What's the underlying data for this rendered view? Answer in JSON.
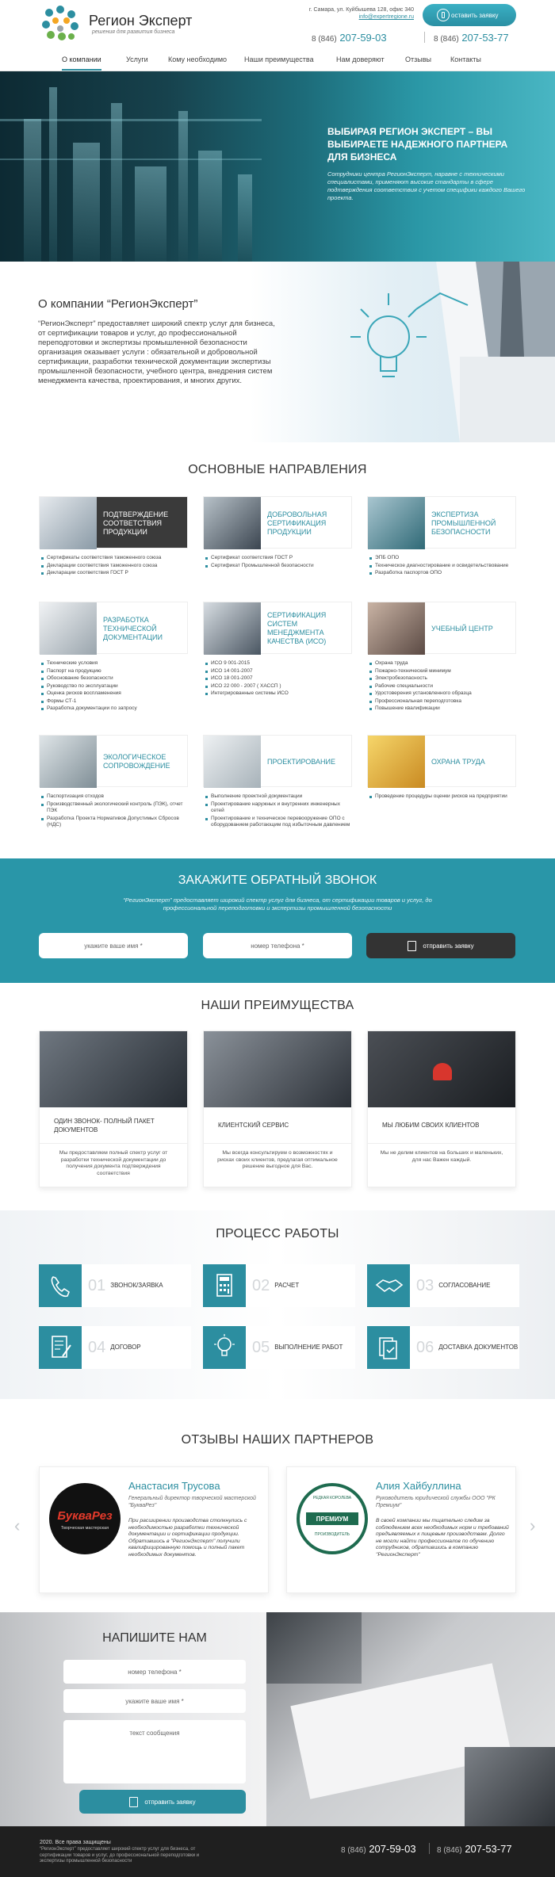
{
  "header": {
    "logo_title": "Регион Эксперт",
    "logo_subtitle": "решения для развития бизнеса",
    "address": "г. Самара, ул. Куйбышева 128, офис 340",
    "email": "info@expertregione.ru",
    "cta_label": "оставить заявку",
    "phone1_prefix": "8 (846)",
    "phone1": "207-59-03",
    "phone2_prefix": "8 (846)",
    "phone2": "207-53-77"
  },
  "nav": {
    "items": [
      "О компании",
      "Услуги",
      "Кому необходимо",
      "Наши преимущества",
      "Нам доверяют",
      "Отзывы",
      "Контакты"
    ],
    "active_index": 0
  },
  "hero": {
    "title": "ВЫБИРАЯ РЕГИОН ЭКСПЕРТ – ВЫ ВЫБИРАЕТЕ НАДЕЖНОГО ПАРТНЕРА ДЛЯ БИЗНЕСА",
    "text": "Сотрудники центра РегионЭксперт, наравне с техническими специалистами, применяют высокие стандарты в сфере подтверждения соответствия с учетом специфики каждого Вашего проекта."
  },
  "about": {
    "title": "О компании “РегионЭксперт”",
    "text": "“РегионЭксперт” предоставляет широкий спектр услуг для бизнеса, от сертификации товаров и услуг, до профессиональной переподготовки и экспертизы промышленной безопасности организация оказывает услуги : обязательной и добровольной сертификации, разработки технической документации экспертизы промышленной безопасности, учебного центра, внедрения систем менеджмента качества, проектирования, и многих других."
  },
  "directions": {
    "title": "ОСНОВНЫЕ НАПРАВЛЕНИЯ",
    "cards": [
      {
        "title": "ПОДТВЕРЖДЕНИЕ СООТВЕТСТВИЯ ПРОДУКЦИИ",
        "items": [
          "Сертификаты соответствия таможенного союза",
          "Декларации соответствия таможенного союза",
          "Декларации соответствия ГОСТ Р"
        ]
      },
      {
        "title": "ДОБРОВОЛЬНАЯ СЕРТИФИКАЦИЯ ПРОДУКЦИИ",
        "items": [
          "Сертификат соответствия ГОСТ Р",
          "Сертификат Промышленной безопасности"
        ]
      },
      {
        "title": "ЭКСПЕРТИЗА ПРОМЫШЛЕННОЙ БЕЗОПАСНОСТИ",
        "items": [
          "ЭПБ ОПО",
          "Техническое диагностирование и освидетельствование",
          "Разработка паспортов ОПО"
        ]
      },
      {
        "title": "РАЗРАБОТКА ТЕХНИЧЕСКОЙ ДОКУМЕНТАЦИИ",
        "items": [
          "Технические условия",
          "Паспорт на продукцию",
          "Обоснование безопасности",
          "Руководство по эксплуатации",
          "Оценка рисков воспламенения",
          "Формы СТ-1",
          "Разработка документации по запросу"
        ]
      },
      {
        "title": "СЕРТИФИКАЦИЯ СИСТЕМ МЕНЕДЖМЕНТА КАЧЕСТВА (ИСО)",
        "items": [
          "ИСО 9 001-2015",
          "ИСО 14 001-2007",
          "ИСО 18 001-2007",
          "ИСО 22 000 - 2007 ( ХАССП )",
          "Интегрированные системы ИСО"
        ]
      },
      {
        "title": "УЧЕБНЫЙ ЦЕНТР",
        "items": [
          "Охрана труда",
          "Пожарно-технический минимум",
          "Электробезопасность",
          "Рабочие специальности",
          "Удостоверения установленного образца",
          "Профессиональная переподготовка",
          "Повышение квалификации"
        ]
      },
      {
        "title": "ЭКОЛОГИЧЕСКОЕ СОПРОВОЖДЕНИЕ",
        "items": [
          "Паспортизация отходов",
          "Производственный экологический контроль (ПЭК), отчет ПЭК",
          "Разработка Проекта Нормативов Допустимых Сбросов (НДС)"
        ]
      },
      {
        "title": "ПРОЕКТИРОВАНИЕ",
        "items": [
          "Выполнение проектной документации",
          "Проектирование наружных и внутренних инженерных сетей",
          "Проектирование и техническое перевооружение ОПО с оборудованием работающим под избыточным давлением"
        ]
      },
      {
        "title": "ОХРАНА ТРУДА",
        "items": [
          "Проведение процедуры оценки рисков на предприятии"
        ]
      }
    ]
  },
  "callback": {
    "title": "ЗАКАЖИТЕ ОБРАТНЫЙ ЗВОНОК",
    "text": "“РегионЭксперт” предоставляет широкий спектр услуг для бизнеса, от сертификации товаров и услуг, до профессиональной переподготовки и экспертизы промышленной безопасности",
    "name_placeholder": "укажите ваше имя *",
    "phone_placeholder": "номер телефона *",
    "send_label": "отправить заявку"
  },
  "advantages": {
    "title": "НАШИ ПРЕИМУЩЕСТВА",
    "items": [
      {
        "title": "ОДИН ЗВОНОК- ПОЛНЫЙ ПАКЕТ ДОКУМЕНТОВ",
        "text": "Мы предоставляем полный спектр услуг от разработки технической документации до получения документа подтверждения соответствия"
      },
      {
        "title": "КЛИЕНТСКИЙ СЕРВИС",
        "text": "Мы всегда консультируем о возможностях и рисках своих клиентов, предлагая оптимальное решение выгодное для Вас."
      },
      {
        "title": "МЫ ЛЮБИМ СВОИХ КЛИЕНТОВ",
        "text": "Мы не делим клиентов на больших и маленьких, для нас Важен каждый."
      }
    ]
  },
  "process": {
    "title": "ПРОЦЕСС РАБОТЫ",
    "steps": [
      {
        "num": "01",
        "label": "ЗВОНОК/ЗАЯВКА",
        "icon": "phone-icon"
      },
      {
        "num": "02",
        "label": "РАСЧЕТ",
        "icon": "calculator-icon"
      },
      {
        "num": "03",
        "label": "СОГЛАСОВАНИЕ",
        "icon": "handshake-icon"
      },
      {
        "num": "04",
        "label": "ДОГОВОР",
        "icon": "contract-icon"
      },
      {
        "num": "05",
        "label": "ВЫПОЛНЕНИЕ РАБОТ",
        "icon": "lightbulb-icon"
      },
      {
        "num": "06",
        "label": "ДОСТАВКА ДОКУМЕНТОВ",
        "icon": "documents-icon"
      }
    ]
  },
  "reviews": {
    "title": "ОТЗЫВЫ НАШИХ ПАРТНЕРОВ",
    "items": [
      {
        "name": "Анастасия Трусова",
        "role": "Генеральный директор творческой мастерской \"БукваРез\"",
        "text": "При расширении производства столкнулись с необходимостью разработки технической документации и сертификации продукции. Обратившись в \"РегионЭксперт\" получили квалифицированную помощь и полный пакет необходимых документов.",
        "logo_text": "БукваРез",
        "logo_sub": "Творческая мастерская"
      },
      {
        "name": "Алия Хайбуллина",
        "role": "Руководитель юридической службы ООО \"РК Премиум\"",
        "text": "В своей компании мы тщательно следим за соблюдением всех необходимых норм и требований предъявляемых к пищевым производствам. Долго не могли найти профессионалов по обучению сотрудников, обратившись в компанию \"РегионЭксперт\"",
        "logo_text": "ПРЕМИУМ",
        "logo_top": "РЕДКАЯ КОРОЛЕВА",
        "logo_bottom": "ПРОИЗВОДИТЕЛЬ"
      }
    ]
  },
  "write": {
    "title": "НАПИШИТЕ НАМ",
    "phone_placeholder": "номер телефона *",
    "name_placeholder": "укажите ваше имя *",
    "message_placeholder": "текст сообщения",
    "send_label": "отправить заявку"
  },
  "footer": {
    "copyright": "2020. Все права защищены",
    "text": "“РегионЭксперт” предоставляет широкий спектр услуг для бизнеса, от сертификации товаров и услуг, до профессиональной переподготовки и экспертизы промышленной безопасности",
    "phone1_prefix": "8 (846)",
    "phone1": "207-59-03",
    "phone2_prefix": "8 (846)",
    "phone2": "207-53-77"
  },
  "colors": {
    "accent": "#2c8ea0",
    "dark": "#333333",
    "footer": "#1f1f1f"
  }
}
